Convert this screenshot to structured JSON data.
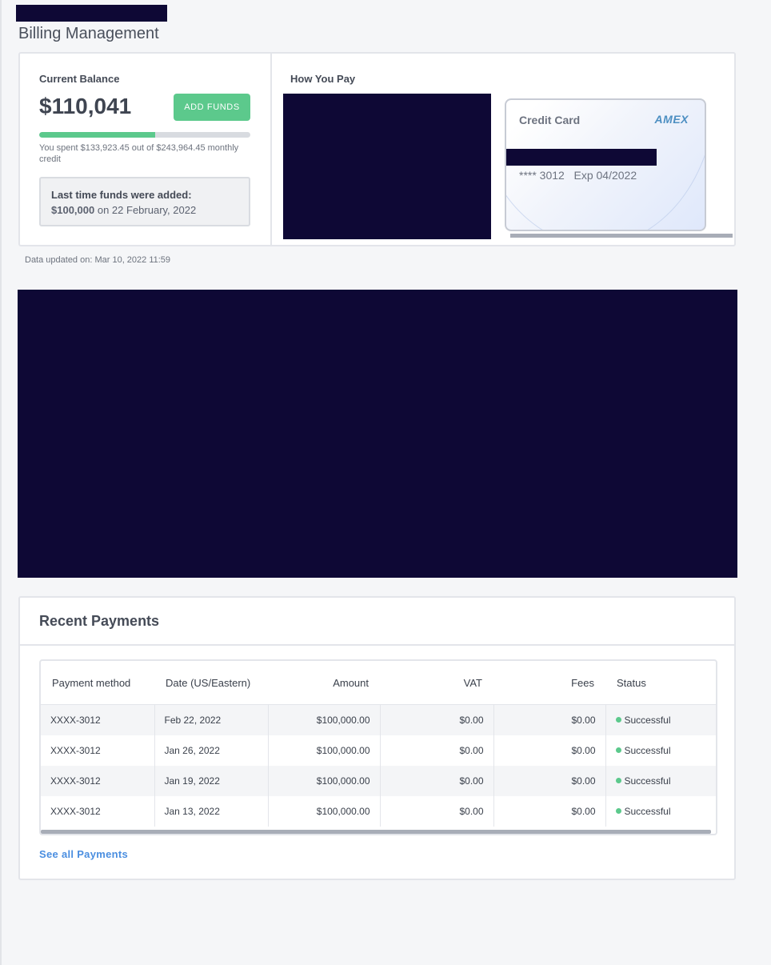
{
  "page": {
    "title": "Billing Management"
  },
  "balance": {
    "label": "Current Balance",
    "amount": "$110,041",
    "add_funds_label": "ADD FUNDS",
    "spent_text": "You spent $133,923.45 out of $243,964.45 monthly credit",
    "progress_fraction": 0.549,
    "last_added_title": "Last time funds were added:",
    "last_added_amount": "$100,000",
    "last_added_date": "on 22 February, 2022"
  },
  "payment_method": {
    "label": "How You Pay",
    "card_type": "Credit Card",
    "card_brand": "AMEX",
    "card_digits": "**** 3012   Exp 04/2022"
  },
  "updated": "Data updated on: Mar 10, 2022 11:59",
  "recent_payments": {
    "title": "Recent Payments",
    "columns": [
      "Payment method",
      "Date (US/Eastern)",
      "Amount",
      "VAT",
      "Fees",
      "Status"
    ],
    "rows": [
      {
        "method": "XXXX-3012",
        "date": "Feb 22, 2022",
        "amount": "$100,000.00",
        "vat": "$0.00",
        "fees": "$0.00",
        "status": "Successful"
      },
      {
        "method": "XXXX-3012",
        "date": "Jan 26, 2022",
        "amount": "$100,000.00",
        "vat": "$0.00",
        "fees": "$0.00",
        "status": "Successful"
      },
      {
        "method": "XXXX-3012",
        "date": "Jan 19, 2022",
        "amount": "$100,000.00",
        "vat": "$0.00",
        "fees": "$0.00",
        "status": "Successful"
      },
      {
        "method": "XXXX-3012",
        "date": "Jan 13, 2022",
        "amount": "$100,000.00",
        "vat": "$0.00",
        "fees": "$0.00",
        "status": "Successful"
      }
    ],
    "see_all_label": "See all Payments"
  },
  "colors": {
    "accent_green": "#5cc98c",
    "link_blue": "#4a8ee0",
    "redaction": "#0e0835"
  }
}
